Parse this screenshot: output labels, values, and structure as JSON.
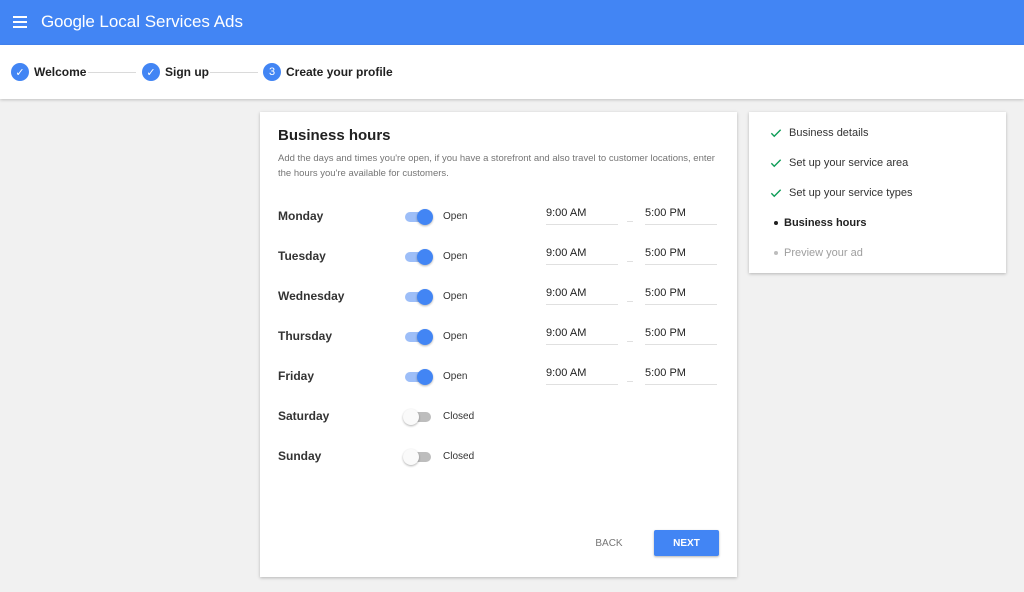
{
  "header": {
    "menu_icon": "hamburger-menu-icon",
    "brand_google": "Google",
    "brand_product": "Local Services Ads",
    "color": "#4285f4"
  },
  "stepper": {
    "steps": [
      {
        "label": "Welcome",
        "state": "done",
        "marker": "✓"
      },
      {
        "label": "Sign up",
        "state": "done",
        "marker": "✓"
      },
      {
        "label": "Create your profile",
        "state": "current",
        "marker": "3"
      }
    ]
  },
  "business_hours": {
    "title": "Business hours",
    "description": "Add the days and times you're open, if you have a storefront and also travel to customer locations, enter the hours you're available for customers.",
    "days": [
      {
        "day": "Monday",
        "open": true,
        "status": "Open",
        "from": "9:00 AM",
        "to": "5:00 PM"
      },
      {
        "day": "Tuesday",
        "open": true,
        "status": "Open",
        "from": "9:00 AM",
        "to": "5:00 PM"
      },
      {
        "day": "Wednesday",
        "open": true,
        "status": "Open",
        "from": "9:00 AM",
        "to": "5:00 PM"
      },
      {
        "day": "Thursday",
        "open": true,
        "status": "Open",
        "from": "9:00 AM",
        "to": "5:00 PM"
      },
      {
        "day": "Friday",
        "open": true,
        "status": "Open",
        "from": "9:00 AM",
        "to": "5:00 PM"
      },
      {
        "day": "Saturday",
        "open": false,
        "status": "Closed"
      },
      {
        "day": "Sunday",
        "open": false,
        "status": "Closed"
      }
    ],
    "back_label": "BACK",
    "next_label": "NEXT"
  },
  "progress": {
    "items": [
      {
        "label": "Business details",
        "state": "done"
      },
      {
        "label": "Set up your service area",
        "state": "done"
      },
      {
        "label": "Set up your service types",
        "state": "done"
      },
      {
        "label": "Business hours",
        "state": "current"
      },
      {
        "label": "Preview your ad",
        "state": "pending"
      }
    ],
    "check_color": "#0f9d58"
  }
}
